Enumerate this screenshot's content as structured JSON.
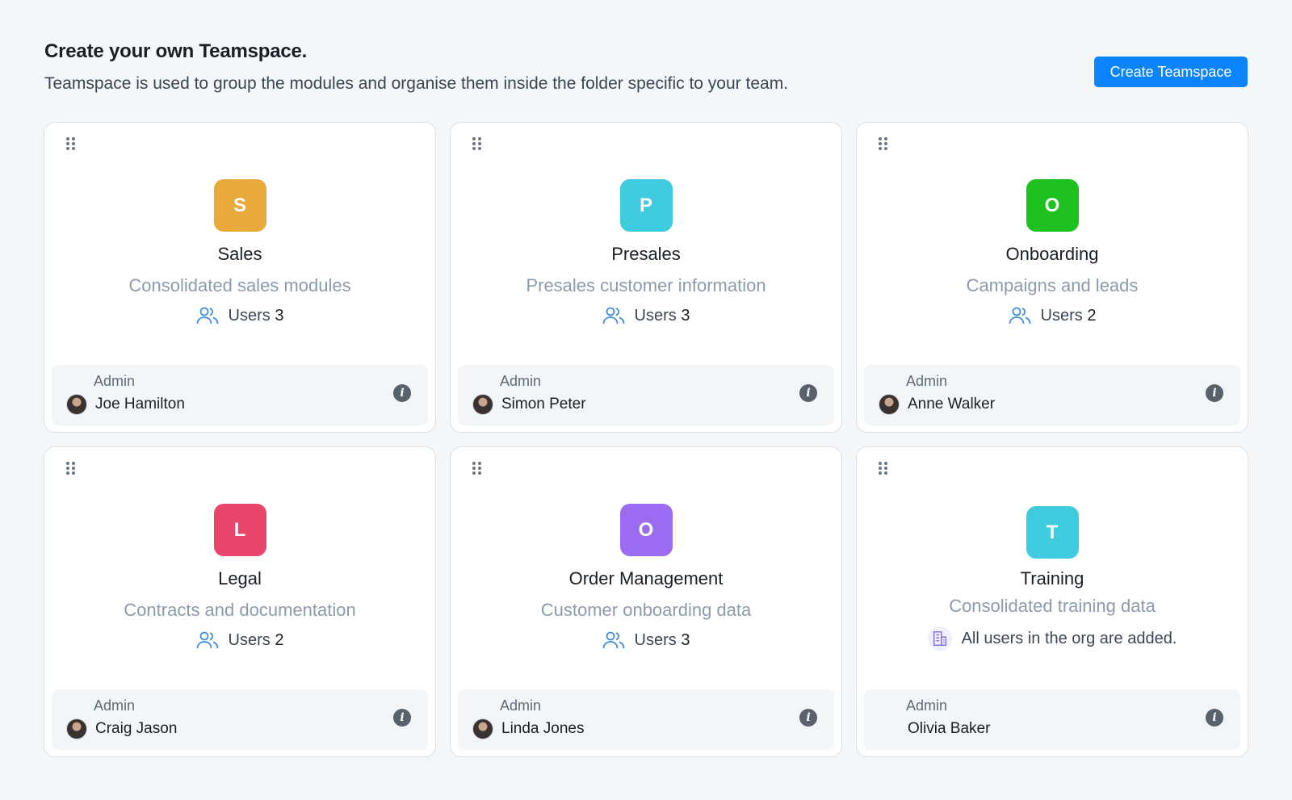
{
  "header": {
    "title": "Create your own Teamspace.",
    "subtitle": "Teamspace is used to group the modules and organise them inside the folder specific to your team.",
    "create_button": "Create Teamspace"
  },
  "admin_label": "Admin",
  "users_label": "Users",
  "colors": {
    "accent": "#0a84ff"
  },
  "teamspaces": [
    {
      "letter": "S",
      "color": "#e8a93a",
      "name": "Sales",
      "description": "Consolidated sales modules",
      "users": "3",
      "admin": "Joe Hamilton"
    },
    {
      "letter": "P",
      "color": "#3ecbde",
      "name": "Presales",
      "description": "Presales customer information",
      "users": "3",
      "admin": "Simon Peter"
    },
    {
      "letter": "O",
      "color": "#1ec21f",
      "name": "Onboarding",
      "description": "Campaigns and leads",
      "users": "2",
      "admin": "Anne Walker"
    },
    {
      "letter": "L",
      "color": "#e8456a",
      "name": "Legal",
      "description": "Contracts and documentation",
      "users": "2",
      "admin": "Craig Jason"
    },
    {
      "letter": "O",
      "color": "#9b6cf2",
      "name": "Order Management",
      "description": "Customer onboarding data",
      "users": "3",
      "admin": "Linda Jones"
    },
    {
      "letter": "T",
      "color": "#3ecbde",
      "name": "Training",
      "description": "Consolidated training data",
      "org_note": "All users in the org are added.",
      "admin": "Olivia Baker"
    }
  ]
}
